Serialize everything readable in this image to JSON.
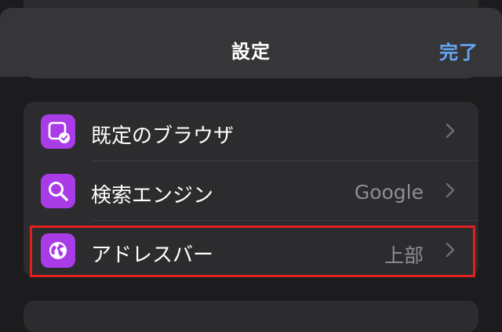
{
  "header": {
    "title": "設定",
    "done_label": "完了"
  },
  "settings": {
    "rows": [
      {
        "label": "既定のブラウザ",
        "value": "",
        "icon": "default-browser-icon"
      },
      {
        "label": "検索エンジン",
        "value": "Google",
        "icon": "search-icon"
      },
      {
        "label": "アドレスバー",
        "value": "上部",
        "icon": "globe-icon"
      }
    ]
  },
  "colors": {
    "background": "#1c1c1e",
    "header": "#363639",
    "group": "#2c2c2e",
    "accent": "#64a7f5",
    "icon_purple": "#a93ce6",
    "highlight": "#e02020"
  }
}
